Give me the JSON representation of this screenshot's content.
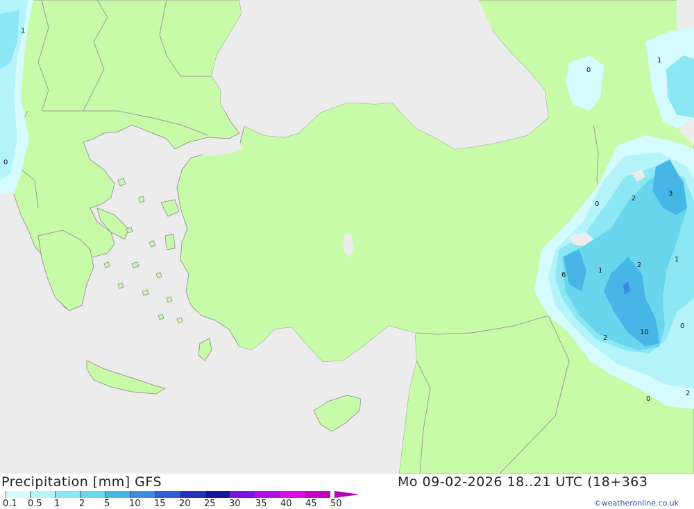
{
  "map": {
    "colors": {
      "sea": "#ececec",
      "land": "#c8fba8",
      "border": "#9a9a9a",
      "precip_0_1": "#d5fbff",
      "precip_0_5": "#b4f3fa",
      "precip_1": "#8ae7f3",
      "precip_2": "#6ad6ee",
      "precip_5": "#46b6e6",
      "precip_10": "#3c8ce0"
    },
    "contour_labels": [
      "1",
      "0",
      "0",
      "1",
      "0",
      "2",
      "3",
      "6",
      "1",
      "2",
      "1",
      "0",
      "2",
      "10",
      "0",
      "2"
    ]
  },
  "footer": {
    "title": "Precipitation [mm] GFS",
    "valid_time": "Mo 09-02-2026 18..21 UTC (18+363",
    "credit": "©weatheronline.co.uk"
  },
  "legend": {
    "labels": [
      "0.1",
      "0.5",
      "1",
      "2",
      "5",
      "10",
      "15",
      "20",
      "25",
      "30",
      "35",
      "40",
      "45",
      "50"
    ],
    "colors": [
      "#d5fbff",
      "#b4f3fa",
      "#8ae7f3",
      "#6ad6ee",
      "#46b6e6",
      "#3c8ce0",
      "#2f5fd8",
      "#2432c0",
      "#1414a0",
      "#8010e0",
      "#b40ce6",
      "#dc0ae6",
      "#c800c8",
      "#b400b4"
    ]
  }
}
